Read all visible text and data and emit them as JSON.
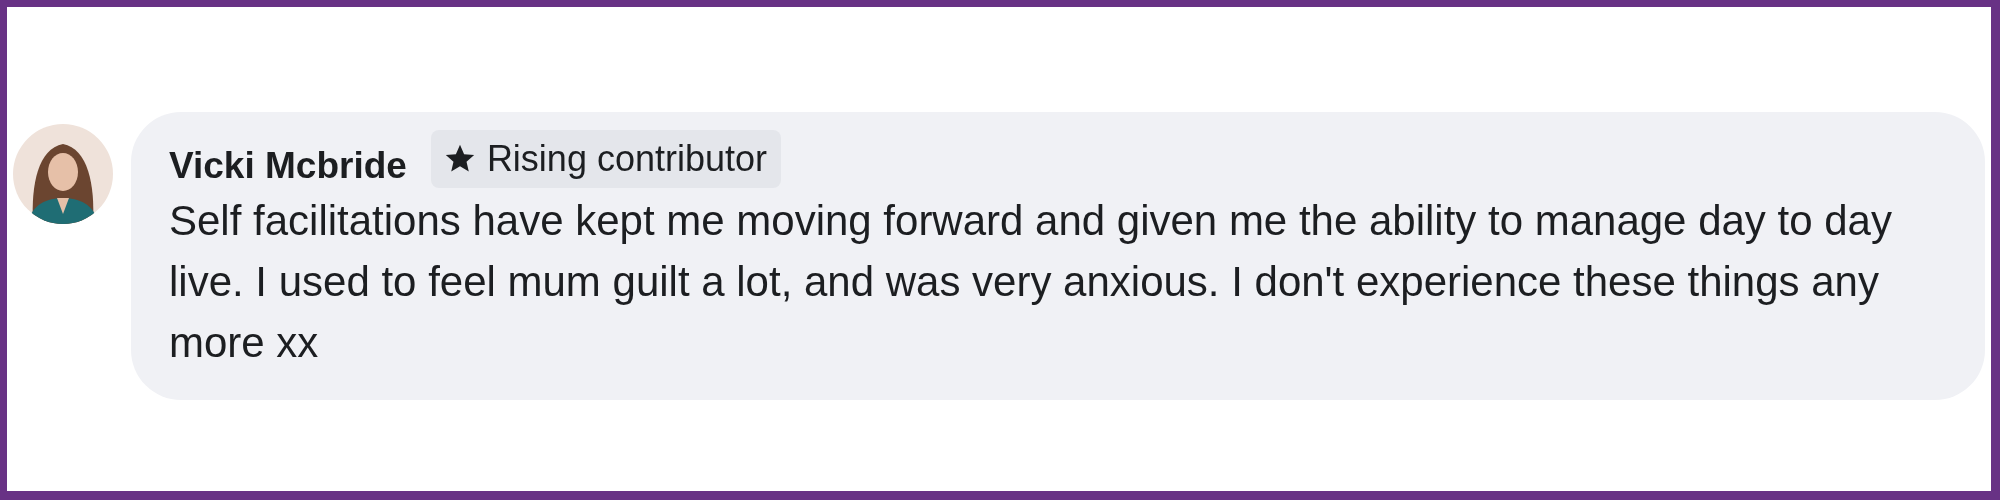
{
  "comment": {
    "author": "Vicki Mcbride",
    "badge": {
      "label": "Rising contributor"
    },
    "text": "Self facilitations have kept me moving forward and given me the ability to manage day to day live. I used to feel mum guilt a lot, and was very anxious. I don't experience these things any more xx"
  }
}
